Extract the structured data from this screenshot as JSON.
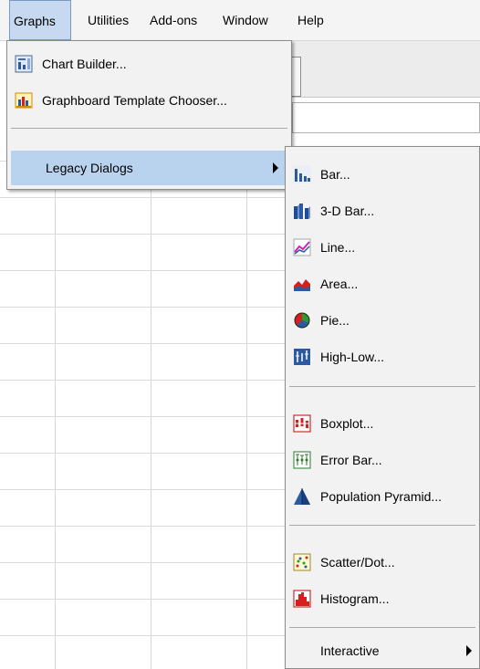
{
  "menubar": {
    "items": [
      {
        "label": "Graphs",
        "mnemonic": "G",
        "active": true
      },
      {
        "label": "Utilities",
        "mnemonic": "U",
        "active": false
      },
      {
        "label": "Add-ons",
        "mnemonic": "o",
        "active": false
      },
      {
        "label": "Window",
        "mnemonic": "W",
        "active": false
      },
      {
        "label": "Help",
        "mnemonic": "H",
        "active": false
      }
    ]
  },
  "graphs_menu": {
    "items": [
      {
        "label": "Chart Builder...",
        "icon": "chart-builder-icon"
      },
      {
        "label": "Graphboard Template Chooser...",
        "icon": "graphboard-icon"
      },
      {
        "label": "Legacy Dialogs",
        "has_submenu": true,
        "highlighted": true
      }
    ]
  },
  "legacy_menu": {
    "items": [
      {
        "label": "Bar...",
        "icon": "bar-chart-icon"
      },
      {
        "label": "3-D Bar...",
        "icon": "3d-bar-icon"
      },
      {
        "label": "Line...",
        "icon": "line-chart-icon"
      },
      {
        "label": "Area...",
        "icon": "area-chart-icon"
      },
      {
        "label": "Pie...",
        "icon": "pie-chart-icon"
      },
      {
        "label": "High-Low...",
        "icon": "high-low-icon"
      },
      {
        "label": "Boxplot...",
        "icon": "boxplot-icon"
      },
      {
        "label": "Error Bar...",
        "icon": "error-bar-icon"
      },
      {
        "label": "Population Pyramid...",
        "icon": "population-pyramid-icon"
      },
      {
        "label": "Scatter/Dot...",
        "icon": "scatter-icon"
      },
      {
        "label": "Histogram...",
        "icon": "histogram-icon"
      },
      {
        "label": "Interactive",
        "has_submenu": true
      }
    ]
  },
  "colors": {
    "highlight": "#b9d2ee",
    "active_menubar": "#c6d9f1",
    "menu_bg": "#f2f2f2"
  }
}
